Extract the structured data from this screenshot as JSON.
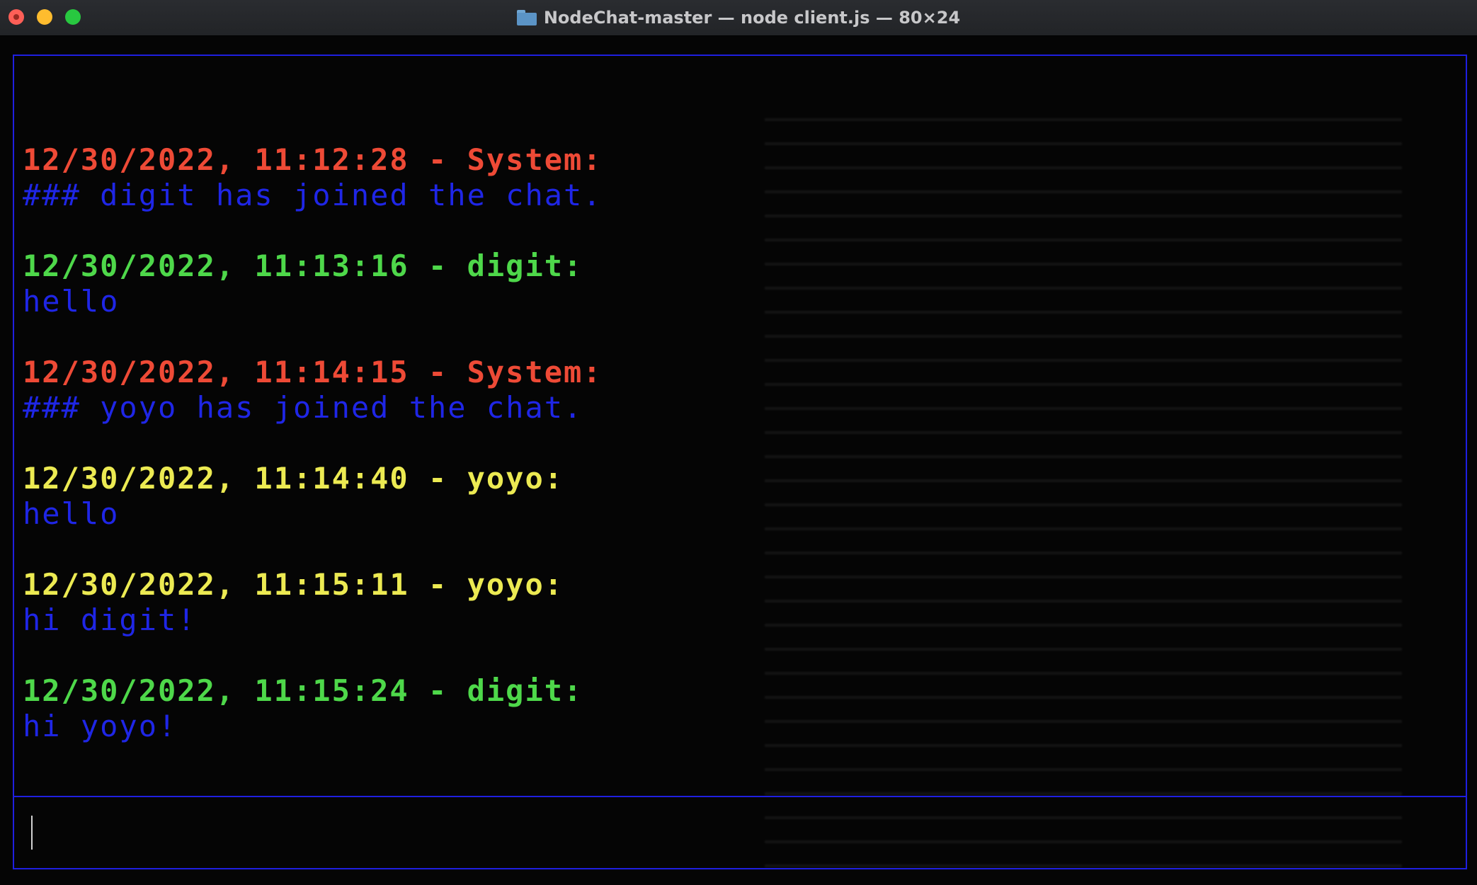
{
  "window": {
    "title": "NodeChat-master — node client.js — 80×24"
  },
  "colors": {
    "system": "#ee4a36",
    "digit": "#4ed84a",
    "yoyo": "#ecea52",
    "body": "#1f26e6",
    "border": "#1f1fe0"
  },
  "messages": [
    {
      "header": "12/30/2022, 11:12:28 - System:",
      "author": "system",
      "body": "### digit has joined the chat."
    },
    {
      "header": "12/30/2022, 11:13:16 - digit:",
      "author": "digit",
      "body": "hello"
    },
    {
      "header": "12/30/2022, 11:14:15 - System:",
      "author": "system",
      "body": "### yoyo has joined the chat."
    },
    {
      "header": "12/30/2022, 11:14:40 - yoyo:",
      "author": "yoyo",
      "body": "hello"
    },
    {
      "header": "12/30/2022, 11:15:11 - yoyo:",
      "author": "yoyo",
      "body": "hi digit!"
    },
    {
      "header": "12/30/2022, 11:15:24 - digit:",
      "author": "digit",
      "body": "hi yoyo!"
    }
  ],
  "input": {
    "value": ""
  }
}
